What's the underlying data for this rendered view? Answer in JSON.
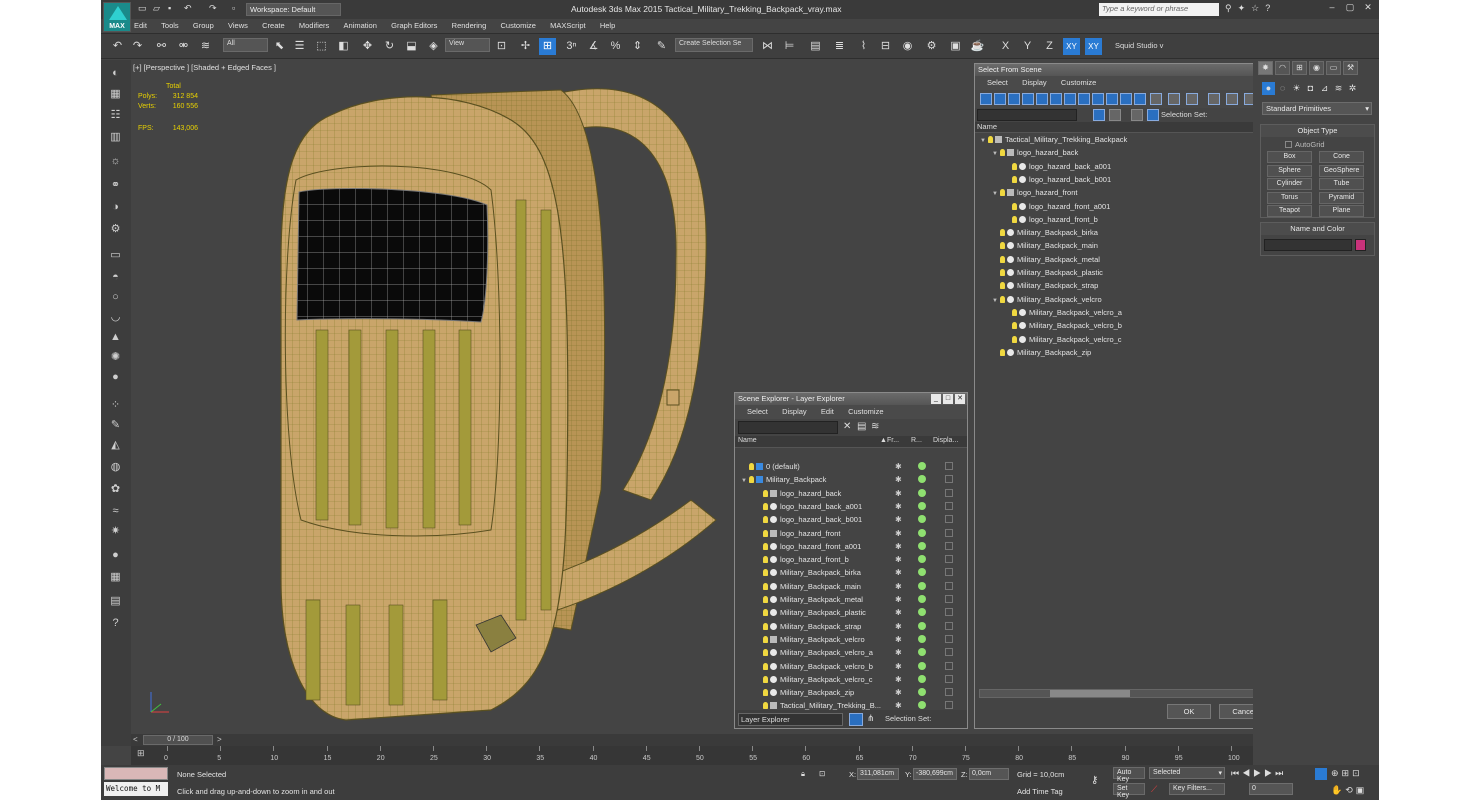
{
  "app": {
    "logo_text": "MAX",
    "workspace": "Workspace: Default",
    "window_title": "Autodesk 3ds Max  2015     Tactical_Military_Trekking_Backpack_vray.max",
    "search_placeholder": "Type a keyword or phrase"
  },
  "menu": [
    "Edit",
    "Tools",
    "Group",
    "Views",
    "Create",
    "Modifiers",
    "Animation",
    "Graph Editors",
    "Rendering",
    "Customize",
    "MAXScript",
    "Help"
  ],
  "toolbar": {
    "selection_filter": "All",
    "ref_coord": "View",
    "named_selection": "Create Selection Se",
    "axis_x": "X",
    "axis_y": "Y",
    "axis_z": "Z",
    "axis_xy": "XY",
    "axis_xy2": "XY",
    "studio": "Squid Studio v"
  },
  "viewport": {
    "label": "[+] [Perspective ] [Shaded + Edged Faces ]",
    "stats_total": "Total",
    "polys_label": "Polys:",
    "polys": "312 854",
    "verts_label": "Verts:",
    "verts": "160 556",
    "fps_label": "FPS:",
    "fps": "143,006"
  },
  "select_from_scene": {
    "title": "Select From Scene",
    "menu": [
      "Select",
      "Display",
      "Customize"
    ],
    "selection_set_label": "Selection Set:",
    "column_name": "Name",
    "tree": [
      {
        "label": "Tactical_Military_Trekking_Backpack",
        "depth": 0,
        "kind": "group",
        "expanded": true
      },
      {
        "label": "logo_hazard_back",
        "depth": 1,
        "kind": "group",
        "expanded": true
      },
      {
        "label": "logo_hazard_back_a001",
        "depth": 2,
        "kind": "object"
      },
      {
        "label": "logo_hazard_back_b001",
        "depth": 2,
        "kind": "object"
      },
      {
        "label": "logo_hazard_front",
        "depth": 1,
        "kind": "group",
        "expanded": true
      },
      {
        "label": "logo_hazard_front_a001",
        "depth": 2,
        "kind": "object"
      },
      {
        "label": "logo_hazard_front_b",
        "depth": 2,
        "kind": "object"
      },
      {
        "label": "Military_Backpack_birka",
        "depth": 1,
        "kind": "object"
      },
      {
        "label": "Military_Backpack_main",
        "depth": 1,
        "kind": "object"
      },
      {
        "label": "Military_Backpack_metal",
        "depth": 1,
        "kind": "object"
      },
      {
        "label": "Military_Backpack_plastic",
        "depth": 1,
        "kind": "object"
      },
      {
        "label": "Military_Backpack_strap",
        "depth": 1,
        "kind": "object"
      },
      {
        "label": "Military_Backpack_velcro",
        "depth": 1,
        "kind": "object",
        "expanded": true
      },
      {
        "label": "Military_Backpack_velcro_a",
        "depth": 2,
        "kind": "object"
      },
      {
        "label": "Military_Backpack_velcro_b",
        "depth": 2,
        "kind": "object"
      },
      {
        "label": "Military_Backpack_velcro_c",
        "depth": 2,
        "kind": "object"
      },
      {
        "label": "Military_Backpack_zip",
        "depth": 1,
        "kind": "object"
      }
    ],
    "ok": "OK",
    "cancel": "Cancel"
  },
  "scene_explorer": {
    "title": "Scene Explorer - Layer Explorer",
    "menu": [
      "Select",
      "Display",
      "Edit",
      "Customize"
    ],
    "col_name": "Name",
    "col_freeze": "Fr...",
    "col_render": "R...",
    "col_display": "Displa...",
    "rows": [
      {
        "label": "0 (default)",
        "depth": 0,
        "kind": "layer"
      },
      {
        "label": "Military_Backpack",
        "depth": 0,
        "kind": "layer",
        "expanded": true
      },
      {
        "label": "logo_hazard_back",
        "depth": 1,
        "kind": "group"
      },
      {
        "label": "logo_hazard_back_a001",
        "depth": 1,
        "kind": "object"
      },
      {
        "label": "logo_hazard_back_b001",
        "depth": 1,
        "kind": "object"
      },
      {
        "label": "logo_hazard_front",
        "depth": 1,
        "kind": "group"
      },
      {
        "label": "logo_hazard_front_a001",
        "depth": 1,
        "kind": "object"
      },
      {
        "label": "logo_hazard_front_b",
        "depth": 1,
        "kind": "object"
      },
      {
        "label": "Military_Backpack_birka",
        "depth": 1,
        "kind": "object"
      },
      {
        "label": "Military_Backpack_main",
        "depth": 1,
        "kind": "object"
      },
      {
        "label": "Military_Backpack_metal",
        "depth": 1,
        "kind": "object"
      },
      {
        "label": "Military_Backpack_plastic",
        "depth": 1,
        "kind": "object"
      },
      {
        "label": "Military_Backpack_strap",
        "depth": 1,
        "kind": "object"
      },
      {
        "label": "Military_Backpack_velcro",
        "depth": 1,
        "kind": "group"
      },
      {
        "label": "Military_Backpack_velcro_a",
        "depth": 1,
        "kind": "object"
      },
      {
        "label": "Military_Backpack_velcro_b",
        "depth": 1,
        "kind": "object"
      },
      {
        "label": "Military_Backpack_velcro_c",
        "depth": 1,
        "kind": "object"
      },
      {
        "label": "Military_Backpack_zip",
        "depth": 1,
        "kind": "object"
      },
      {
        "label": "Tactical_Military_Trekking_B...",
        "depth": 1,
        "kind": "group"
      }
    ],
    "explorer_type": "Layer Explorer",
    "selection_set_label": "Selection Set:"
  },
  "command_panel": {
    "category": "Standard Primitives",
    "object_type_title": "Object Type",
    "autogrid": "AutoGrid",
    "primitives": [
      "Box",
      "Cone",
      "Sphere",
      "GeoSphere",
      "Cylinder",
      "Tube",
      "Torus",
      "Pyramid",
      "Teapot",
      "Plane"
    ],
    "name_color_title": "Name and Color",
    "object_color": "#c8327a"
  },
  "timeline": {
    "frame_display": "0 / 100",
    "ticks": [
      "0",
      "5",
      "10",
      "15",
      "20",
      "25",
      "30",
      "35",
      "40",
      "45",
      "50",
      "55",
      "60",
      "65",
      "70",
      "75",
      "80",
      "85",
      "90",
      "95",
      "100"
    ]
  },
  "status": {
    "maxscript_listener": "Welcome to M",
    "selection": "None Selected",
    "prompt": "Click and drag up-and-down to zoom in and out",
    "x_label": "X:",
    "x_value": "311,081cm",
    "y_label": "Y:",
    "y_value": "-380,699cm",
    "z_label": "Z:",
    "z_value": "0,0cm",
    "grid": "Grid = 10,0cm",
    "add_time_tag": "Add Time Tag",
    "auto_key": "Auto Key",
    "set_key": "Set Key",
    "key_mode": "Selected",
    "key_filters": "Key Filters...",
    "current_frame": "0"
  },
  "colors": {
    "ui_background": "#444444",
    "accent_blue": "#2a7bd4",
    "stats_yellow": "#e8d100",
    "backpack_tan": "#c9a56a",
    "mesh_olive": "#9a8f28"
  }
}
